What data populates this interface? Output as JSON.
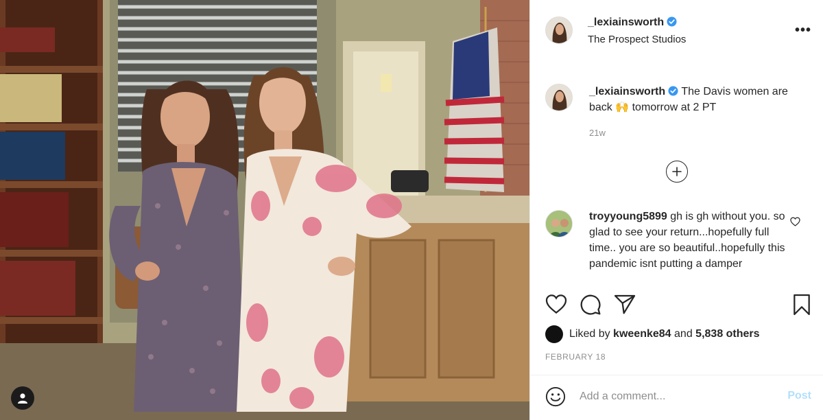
{
  "post": {
    "author": "_lexiainsworth",
    "location": "The Prospect Studios",
    "verified": true,
    "more_label": "•••",
    "caption": "The Davis women are back 🙌 tomorrow at 2 PT",
    "caption_time": "21w",
    "likes_prefix": "Liked by",
    "liked_by_user": "kweenke84",
    "likes_joiner": "and",
    "likes_others": "5,838 others",
    "date": "February 18"
  },
  "comments": [
    {
      "author": "troyyoung5899",
      "text": "gh is gh without you. so glad to see your return...hopefully full time.. you are so beautiful..hopefully this pandemic isnt putting a damper"
    }
  ],
  "comment_box": {
    "placeholder": "Add a comment...",
    "post_label": "Post"
  },
  "icons": {
    "like": "heart-icon",
    "comment": "comment-bubble-icon",
    "share": "paper-plane-icon",
    "save": "bookmark-icon",
    "emoji": "smiley-icon",
    "load_more": "plus-circle-icon",
    "tag": "user-tag-icon"
  },
  "colors": {
    "verified": "#3897f0",
    "text": "#262626",
    "muted": "#8e8e8e",
    "post_disabled": "#b2dffc"
  }
}
